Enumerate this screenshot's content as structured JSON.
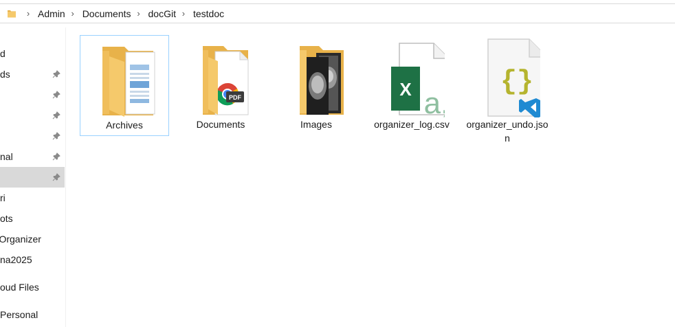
{
  "breadcrumb": {
    "items": [
      "Admin",
      "Documents",
      "docGit",
      "testdoc"
    ]
  },
  "nav": {
    "items": [
      {
        "label": "d",
        "pinned": false,
        "selected": false
      },
      {
        "label": "ds",
        "pinned": true,
        "selected": false
      },
      {
        "label": "",
        "pinned": true,
        "selected": false
      },
      {
        "label": "",
        "pinned": true,
        "selected": false
      },
      {
        "label": "",
        "pinned": true,
        "selected": false
      },
      {
        "label": "nal",
        "pinned": true,
        "selected": false
      },
      {
        "label": "",
        "pinned": true,
        "selected": true
      },
      {
        "label": "ri",
        "pinned": false,
        "selected": false
      },
      {
        "label": "ots",
        "pinned": false,
        "selected": false
      },
      {
        "label": "e-Organizer",
        "pinned": false,
        "selected": false
      },
      {
        "label": "na2025",
        "pinned": false,
        "selected": false
      },
      {
        "label": "oud Files",
        "pinned": false,
        "selected": false
      },
      {
        "label": "Personal",
        "pinned": false,
        "selected": false
      }
    ]
  },
  "files": [
    {
      "name": "Archives",
      "kind": "folder-document",
      "selected": true
    },
    {
      "name": "Documents",
      "kind": "folder-pdf",
      "selected": false
    },
    {
      "name": "Images",
      "kind": "folder-photo",
      "selected": false
    },
    {
      "name": "organizer_log.csv",
      "kind": "excel-csv",
      "selected": false
    },
    {
      "name": "organizer_undo.json",
      "kind": "vscode-json",
      "selected": false
    }
  ],
  "colors": {
    "folder": "#f5c96b",
    "folder_dark": "#e8b24a",
    "excel": "#1e7145",
    "vscode": "#1f8ad2",
    "json_braces": "#b5b42f",
    "selection_border": "#99d1ff"
  }
}
